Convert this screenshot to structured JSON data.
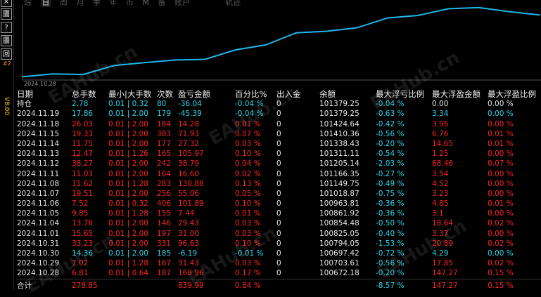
{
  "sidebar": {
    "buttons": [
      "圕",
      "?",
      "圕",
      "回"
    ],
    "vertical_text": [
      "V8.00",
      "#2"
    ]
  },
  "tabs": [
    "综",
    "日",
    "周",
    "月",
    "季",
    "年",
    "币",
    "M",
    "备",
    "账户"
  ],
  "active_tab": "日",
  "chart_title": "轨迹",
  "chart_date": "2024.10.28",
  "colors": {
    "line": "#1fb6e8",
    "red": "#ff2424",
    "cyan": "#2bd6ea"
  },
  "table": {
    "headers": [
      "日期",
      "总手数",
      "最小|大手数",
      "次数",
      "盈亏金额",
      "百分比%",
      "出入金",
      "余额",
      "最大浮亏比例",
      "最大浮盈金额",
      "最大浮盈比例"
    ],
    "rows": [
      {
        "date": "持仓",
        "lots": "2.78",
        "minmax": "0.01 | 0.32",
        "count": "80",
        "pl": "-36.04",
        "pct": "-0.04 %",
        "io": "0",
        "bal": "101379.25",
        "maxloss": "-0.04 %",
        "maxgain": "0.00",
        "maxgainpct": "0.00 %",
        "tone": "hold"
      },
      {
        "date": "2024.11.19",
        "lots": "17.86",
        "minmax": "0.01 | 2.00",
        "count": "179",
        "pl": "-45.39",
        "pct": "-0.04 %",
        "io": "0",
        "bal": "101379.25",
        "maxloss": "-0.63 %",
        "maxgain": "3.34",
        "maxgainpct": "0.00 %",
        "tone": "cyan"
      },
      {
        "date": "2024.11.18",
        "lots": "26.03",
        "minmax": "0.01 | 2.00",
        "count": "184",
        "pl": "14.28",
        "pct": "0.01 %",
        "io": "0",
        "bal": "101424.64",
        "maxloss": "-0.42 %",
        "maxgain": "3.96",
        "maxgainpct": "0.00 %",
        "tone": "red"
      },
      {
        "date": "2024.11.15",
        "lots": "19.33",
        "minmax": "0.01 | 2.00",
        "count": "383",
        "pl": "71.93",
        "pct": "0.07 %",
        "io": "0",
        "bal": "101410.36",
        "maxloss": "-0.56 %",
        "maxgain": "6.76",
        "maxgainpct": "0.01 %",
        "tone": "red"
      },
      {
        "date": "2024.11.14",
        "lots": "11.75",
        "minmax": "0.01 | 2.00",
        "count": "177",
        "pl": "27.32",
        "pct": "0.03 %",
        "io": "0",
        "bal": "101338.43",
        "maxloss": "-0.20 %",
        "maxgain": "14.65",
        "maxgainpct": "0.01 %",
        "tone": "red"
      },
      {
        "date": "2024.11.13",
        "lots": "12.47",
        "minmax": "0.01 | 1.26",
        "count": "165",
        "pl": "105.97",
        "pct": "0.10 %",
        "io": "0",
        "bal": "101311.11",
        "maxloss": "-0.54 %",
        "maxgain": "1.25",
        "maxgainpct": "0.00 %",
        "tone": "red"
      },
      {
        "date": "2024.11.12",
        "lots": "38.27",
        "minmax": "0.01 | 2.00",
        "count": "242",
        "pl": "38.79",
        "pct": "0.04 %",
        "io": "0",
        "bal": "101205.14",
        "maxloss": "-2.03 %",
        "maxgain": "68.46",
        "maxgainpct": "0.07 %",
        "tone": "red"
      },
      {
        "date": "2024.11.11",
        "lots": "11.03",
        "minmax": "0.01 | 2.00",
        "count": "164",
        "pl": "16.60",
        "pct": "0.02 %",
        "io": "0",
        "bal": "101166.35",
        "maxloss": "-0.27 %",
        "maxgain": "3.54",
        "maxgainpct": "0.00 %",
        "tone": "red"
      },
      {
        "date": "2024.11.08",
        "lots": "11.62",
        "minmax": "0.01 | 1.28",
        "count": "283",
        "pl": "130.88",
        "pct": "0.13 %",
        "io": "0",
        "bal": "101149.75",
        "maxloss": "-0.49 %",
        "maxgain": "4.52",
        "maxgainpct": "0.00 %",
        "tone": "red"
      },
      {
        "date": "2024.11.07",
        "lots": "19.51",
        "minmax": "0.01 | 2.00",
        "count": "256",
        "pl": "55.06",
        "pct": "0.05 %",
        "io": "0",
        "bal": "101018.87",
        "maxloss": "-0.75 %",
        "maxgain": "3.23",
        "maxgainpct": "0.00 %",
        "tone": "red"
      },
      {
        "date": "2024.11.06",
        "lots": "7.52",
        "minmax": "0.01 | 0.32",
        "count": "406",
        "pl": "101.89",
        "pct": "0.10 %",
        "io": "0",
        "bal": "100963.81",
        "maxloss": "-0.36 %",
        "maxgain": "4.85",
        "maxgainpct": "0.01 %",
        "tone": "red"
      },
      {
        "date": "2024.11.05",
        "lots": "9.85",
        "minmax": "0.01 | 1.28",
        "count": "155",
        "pl": "7.44",
        "pct": "0.01 %",
        "io": "0",
        "bal": "100861.92",
        "maxloss": "-0.36 %",
        "maxgain": "3.1",
        "maxgainpct": "0.00 %",
        "tone": "red"
      },
      {
        "date": "2024.11.04",
        "lots": "13.76",
        "minmax": "0.01 | 2.00",
        "count": "146",
        "pl": "29.43",
        "pct": "0.03 %",
        "io": "0",
        "bal": "100854.48",
        "maxloss": "-0.50 %",
        "maxgain": "18.64",
        "maxgainpct": "0.02 %",
        "tone": "red"
      },
      {
        "date": "2024.11.01",
        "lots": "15.65",
        "minmax": "0.01 | 2.00",
        "count": "197",
        "pl": "31.00",
        "pct": "0.03 %",
        "io": "0",
        "bal": "100825.05",
        "maxloss": "-0.40 %",
        "maxgain": "3.37",
        "maxgainpct": "0.00 %",
        "tone": "red"
      },
      {
        "date": "2024.10.31",
        "lots": "33.23",
        "minmax": "0.01 | 2.00",
        "count": "331",
        "pl": "96.63",
        "pct": "0.10 %",
        "io": "0",
        "bal": "100794.05",
        "maxloss": "-1.53 %",
        "maxgain": "20.89",
        "maxgainpct": "0.02 %",
        "tone": "red"
      },
      {
        "date": "2024.10.30",
        "lots": "14.36",
        "minmax": "0.01 | 2.00",
        "count": "185",
        "pl": "-6.19",
        "pct": "-0.01 %",
        "io": "0",
        "bal": "100697.42",
        "maxloss": "-0.72 %",
        "maxgain": "4.29",
        "maxgainpct": "0.00 %",
        "tone": "cyan"
      },
      {
        "date": "2024.10.29",
        "lots": "7.02",
        "minmax": "0.01 | 1.28",
        "count": "167",
        "pl": "31.43",
        "pct": "0.03 %",
        "io": "0",
        "bal": "100703.61",
        "maxloss": "-0.56 %",
        "maxgain": "17.85",
        "maxgainpct": "0.02 %",
        "tone": "red"
      },
      {
        "date": "2024.10.28",
        "lots": "6.81",
        "minmax": "0.01 | 0.64",
        "count": "187",
        "pl": "168.96",
        "pct": "0.17 %",
        "io": "0",
        "bal": "100672.18",
        "maxloss": "-0.20 %",
        "maxgain": "147.27",
        "maxgainpct": "0.15 %",
        "tone": "red"
      }
    ],
    "total": {
      "date": "合计",
      "lots": "278.85",
      "minmax": "",
      "count": "",
      "pl": "839.99",
      "pct": "0.84 %",
      "io": "",
      "bal": "",
      "maxloss": "-8.57 %",
      "maxgain": "147.27",
      "maxgainpct": "0.15 %"
    }
  },
  "watermark": "EAHub.cn",
  "chart_data": {
    "type": "line",
    "x": [
      "2024.10.28",
      "2024.10.29",
      "2024.10.30",
      "2024.10.31",
      "2024.11.01",
      "2024.11.04",
      "2024.11.05",
      "2024.11.06",
      "2024.11.07",
      "2024.11.08",
      "2024.11.11",
      "2024.11.12",
      "2024.11.13",
      "2024.11.14",
      "2024.11.15",
      "2024.11.18",
      "2024.11.19",
      "持仓"
    ],
    "values": [
      100672.18,
      100703.61,
      100697.42,
      100794.05,
      100825.05,
      100854.48,
      100861.92,
      100963.81,
      101018.87,
      101149.75,
      101166.35,
      101205.14,
      101311.11,
      101338.43,
      101410.36,
      101424.64,
      101379.25,
      101343.21
    ]
  }
}
